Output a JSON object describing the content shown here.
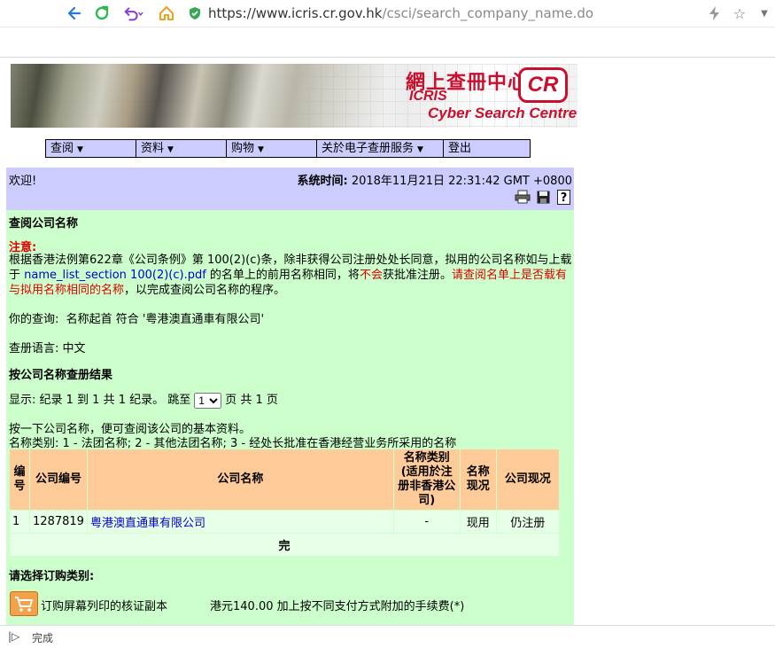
{
  "browser": {
    "url_host": "https://www.icris.cr.gov.hk",
    "url_path": "/csci/search_company_name.do",
    "status_text": "完成"
  },
  "banner": {
    "title_zh": "網上查冊中心",
    "title_en_line1": "ICRIS",
    "title_en_line2": "Cyber Search Centre",
    "logo_text": "CR"
  },
  "menu": {
    "items": [
      {
        "label": "查阅"
      },
      {
        "label": "资料"
      },
      {
        "label": "购物"
      },
      {
        "label": "关於电子查册服务"
      },
      {
        "label": "登出"
      }
    ]
  },
  "welcome": {
    "greeting": "欢迎!",
    "sys_time_label": "系统时间:",
    "sys_time_value": "2018年11月21日 22:31:42 GMT +0800"
  },
  "page": {
    "heading": "查阅公司名称",
    "notice_label": "注意:",
    "notice_part1": "根据香港法例第622章《公司条例》第 100(2)(c)条，除非获得公司注册处处长同意，拟用的公司名称如与上载于 ",
    "notice_link": "name_list_section 100(2)(c).pdf",
    "notice_part2": " 的名单上的前用名称相同，将",
    "notice_red1": "不会",
    "notice_part3": "获批准注册。",
    "notice_red2": "请查阅名单上是否载有与拟用名称相同的名称",
    "notice_part4": "，以完成查阅公司名称的程序。",
    "query_label": "你的查询:",
    "query_value": "名称起首 符合 '粤港澳直通車有限公司'",
    "lang_label": "查册语言:",
    "lang_value": "中文",
    "results_heading": "按公司名称查册结果",
    "display_prefix": "显示: 纪录 1 到 1 共 1 纪录。 跳至",
    "jump_value": "1",
    "display_suffix": "页  共 1 页",
    "instruction1": "按一下公司名称，便可查阅该公司的基本资料。",
    "instruction2": "名称类别: 1 - 法团名称; 2 - 其他法团名称; 3 - 经处长批准在香港经营业务所采用的名称"
  },
  "table": {
    "headers": {
      "no": "编号",
      "company_no": "公司编号",
      "company_name": "公司名称",
      "name_type": "名称类别(适用於注册非香港公司)",
      "name_status": "名称现况",
      "company_status": "公司现况"
    },
    "rows": [
      {
        "no": "1",
        "company_no": "1287819",
        "company_name": "粤港澳直通車有限公司",
        "name_type": "-",
        "name_status": "现用",
        "company_status": "仍注册"
      }
    ],
    "end_label": "完"
  },
  "order": {
    "heading": "请选择订购类别:",
    "item_label": "订购屏幕列印的核证副本",
    "item_price": "港元140.00 加上按不同支付方式附加的手续费(*)"
  }
}
